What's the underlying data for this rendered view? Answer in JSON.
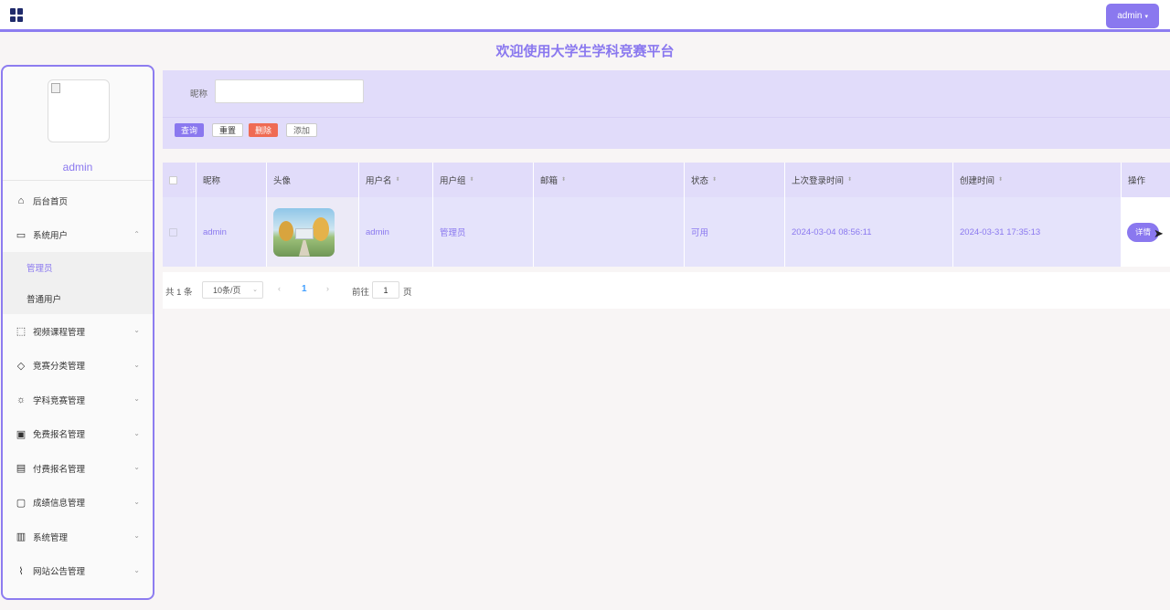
{
  "header": {
    "user_button": "admin",
    "user_button_caret": "▾",
    "site_title": "欢迎使用大学生学科竞赛平台"
  },
  "sidebar": {
    "username": "admin",
    "items": [
      {
        "label": "后台首页",
        "icon": "home-icon",
        "glyph": "⌂"
      },
      {
        "label": "系统用户",
        "icon": "monitor-icon",
        "glyph": "▭",
        "expanded": true
      },
      {
        "label": "视频课程管理",
        "icon": "bookmark-icon",
        "glyph": "⬚"
      },
      {
        "label": "竞赛分类管理",
        "icon": "tag-icon",
        "glyph": "◇"
      },
      {
        "label": "学科竞赛管理",
        "icon": "sun-icon",
        "glyph": "☼"
      },
      {
        "label": "免费报名管理",
        "icon": "inbox-icon",
        "glyph": "▣"
      },
      {
        "label": "付费报名管理",
        "icon": "clipboard-icon",
        "glyph": "▤"
      },
      {
        "label": "成绩信息管理",
        "icon": "message-icon",
        "glyph": "▢"
      },
      {
        "label": "系统管理",
        "icon": "archive-icon",
        "glyph": "▥"
      },
      {
        "label": "网站公告管理",
        "icon": "paperclip-icon",
        "glyph": "⌇"
      }
    ],
    "subitems": [
      {
        "label": "管理员",
        "active": true
      },
      {
        "label": "普通用户",
        "active": false
      }
    ],
    "chevron_collapsed": "⌄",
    "chevron_expanded": "⌃"
  },
  "search": {
    "nickname_label": "昵称",
    "nickname_value": "",
    "query_button": "查询",
    "reset_button": "重置",
    "delete_button": "删除",
    "add_button": "添加"
  },
  "table": {
    "headers": {
      "nickname": "昵称",
      "avatar": "头像",
      "username": "用户名",
      "group": "用户组",
      "email": "邮箱",
      "status": "状态",
      "last_login": "上次登录时间",
      "created": "创建时间",
      "actions": "操作"
    },
    "sort_glyph": "⬍",
    "rows": [
      {
        "nickname": "admin",
        "username": "admin",
        "group": "管理员",
        "email": "",
        "status": "可用",
        "last_login": "2024-03-04 08:56:11",
        "created": "2024-03-31 17:35:13",
        "action": "详情"
      }
    ]
  },
  "pagination": {
    "total": "共 1 条",
    "page_size": "10条/页",
    "current_page": "1",
    "goto_label": "前往",
    "goto_value": "1",
    "page_unit": "页",
    "prev_glyph": "‹",
    "next_glyph": "›"
  },
  "colors": {
    "accent": "#8a78ef",
    "panel": "#e1dcfa",
    "danger": "#ef6b53",
    "link": "#409eff"
  }
}
